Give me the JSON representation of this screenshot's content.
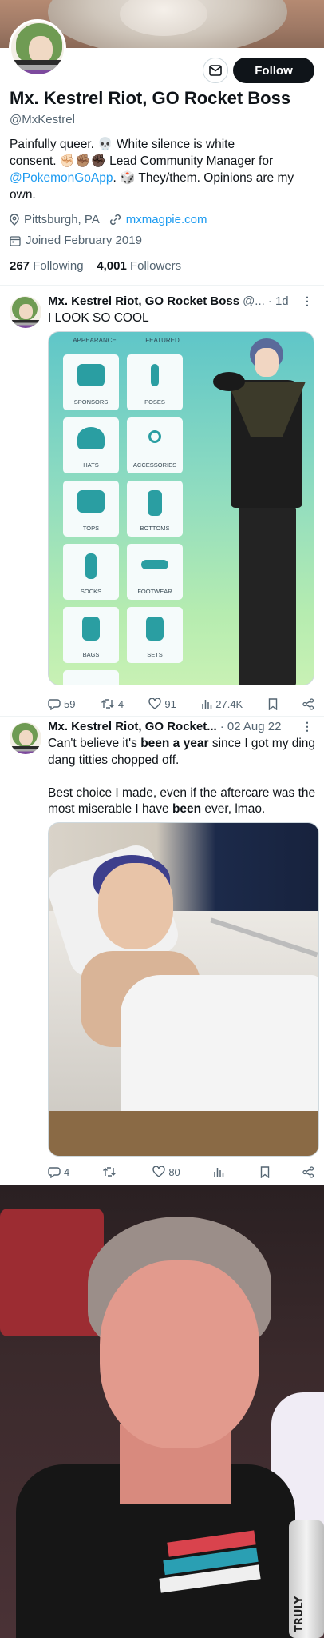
{
  "profile": {
    "name": "Mx. Kestrel Riot, GO Rocket Boss",
    "handle": "@MxKestrel",
    "bio_line1": "Painfully queer. 💀 White silence is white",
    "bio_line2": "consent. ✊🏻✊🏽✊🏿 Lead Community Manager for",
    "bio_link": "@PokemonGoApp",
    "bio_line3_rest": ". 🎲 They/them. Opinions are my",
    "bio_line4": "own.",
    "location": "Pittsburgh, PA",
    "website": "mxmagpie.com",
    "joined": "Joined February 2019",
    "following_count": "267",
    "following_label": "Following",
    "followers_count": "4,001",
    "followers_label": "Followers",
    "follow_label": "Follow"
  },
  "tweets": [
    {
      "name": "Mx. Kestrel Riot, GO Rocket Boss",
      "handle": "@...",
      "time": "· 1d",
      "text": "I LOOK SO COOL",
      "media": {
        "tabs": [
          "APPEARANCE",
          "FEATURED"
        ],
        "tiles": [
          "SPONSORS",
          "POSES",
          "HATS",
          "ACCESSORIES",
          "TOPS",
          "BOTTOMS",
          "SOCKS",
          "FOOTWEAR",
          "BAGS",
          "SETS"
        ]
      },
      "replies": "59",
      "retweets": "4",
      "likes": "91",
      "views": "27.4K"
    },
    {
      "name": "Mx. Kestrel Riot, GO Rocket...",
      "time": "· 02 Aug 22",
      "text_p1_a": "Can't believe it's ",
      "text_p1_b": "been a year",
      "text_p1_c": " since I got my ding dang titties chopped off.",
      "text_p2_a": "Best choice I made, even if the aftercare was the most miserable I have ",
      "text_p2_b": "been",
      "text_p2_c": " ever, lmao.",
      "replies": "4",
      "retweets": "",
      "likes": "80",
      "views": ""
    }
  ],
  "photo3": {
    "can_text": "TRULY"
  },
  "colors": {
    "accent": "#1d9bf0",
    "text": "#0f1419",
    "muted": "#536471"
  }
}
